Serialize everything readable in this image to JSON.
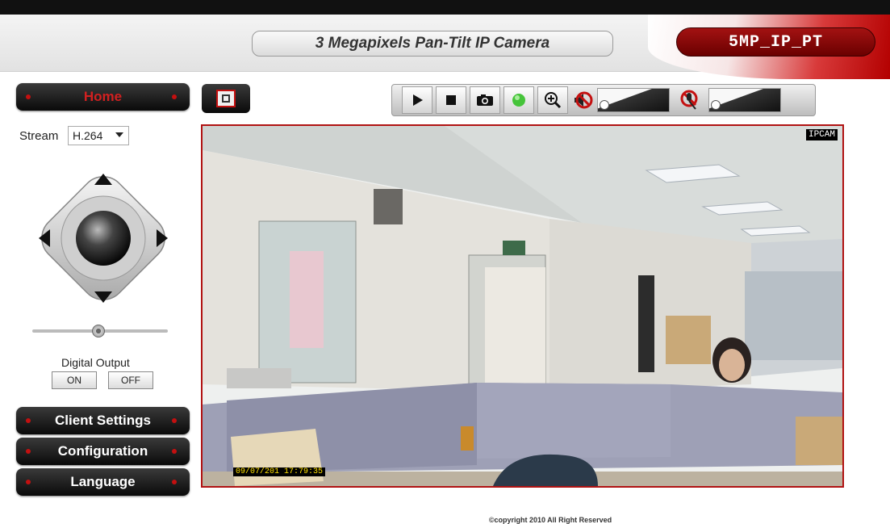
{
  "header": {
    "title": "3 Megapixels Pan-Tilt IP Camera",
    "model": "5MP_IP_PT"
  },
  "nav": {
    "home": "Home",
    "client_settings": "Client Settings",
    "configuration": "Configuration",
    "language": "Language"
  },
  "stream": {
    "label": "Stream",
    "selected": "H.264"
  },
  "digital_output": {
    "label": "Digital Output",
    "on": "ON",
    "off": "OFF"
  },
  "video": {
    "overlay_tag": "IPCAM",
    "timestamp": "09/07/201  17:79:35"
  },
  "toolbar": {
    "icons": [
      "play-icon",
      "stop-icon",
      "snapshot-icon",
      "record-indicator-icon",
      "zoom-in-icon",
      "speaker-mute-icon",
      "microphone-mute-icon"
    ],
    "record_indicator_color": "#46c43a",
    "accent_color": "#c41010"
  },
  "footer": {
    "copyright": "©copyright 2010 All Right Reserved"
  }
}
